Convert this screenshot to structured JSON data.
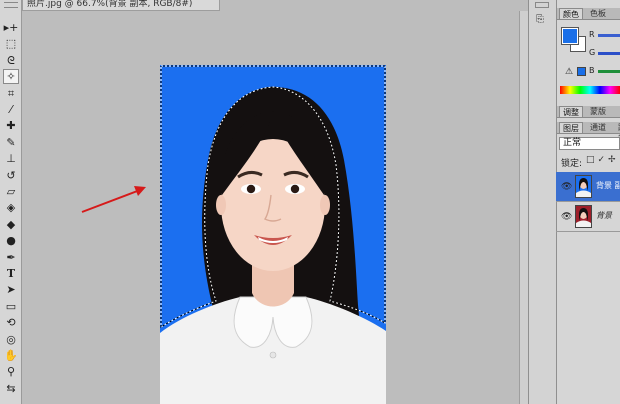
{
  "document": {
    "tab_title": "照片.jpg @ 66.7%(背景 副本, RGB/8#)"
  },
  "toolbar": {
    "tools": [
      {
        "icon": "move-icon",
        "glyph": "▸+"
      },
      {
        "icon": "marquee-icon",
        "glyph": "⬚"
      },
      {
        "icon": "lasso-icon",
        "glyph": "ᘓ"
      },
      {
        "icon": "magic-wand-icon",
        "glyph": "✧",
        "active": true
      },
      {
        "icon": "crop-icon",
        "glyph": "⌗"
      },
      {
        "icon": "eyedropper-icon",
        "glyph": "⁄"
      },
      {
        "icon": "healing-brush-icon",
        "glyph": "✚"
      },
      {
        "icon": "brush-icon",
        "glyph": "✎"
      },
      {
        "icon": "clone-stamp-icon",
        "glyph": "⊥"
      },
      {
        "icon": "history-brush-icon",
        "glyph": "↺"
      },
      {
        "icon": "eraser-icon",
        "glyph": "▱"
      },
      {
        "icon": "paint-bucket-icon",
        "glyph": "◈"
      },
      {
        "icon": "blur-icon",
        "glyph": "◆"
      },
      {
        "icon": "dodge-icon",
        "glyph": "●"
      },
      {
        "icon": "pen-icon",
        "glyph": "✒"
      },
      {
        "icon": "type-icon",
        "glyph": "T"
      },
      {
        "icon": "path-selection-icon",
        "glyph": "➤"
      },
      {
        "icon": "shape-icon",
        "glyph": "▭"
      },
      {
        "icon": "3d-rotate-icon",
        "glyph": "⟲"
      },
      {
        "icon": "3d-orbit-icon",
        "glyph": "◎"
      },
      {
        "icon": "hand-icon",
        "glyph": "✋"
      },
      {
        "icon": "zoom-icon",
        "glyph": "⚲"
      },
      {
        "icon": "swap-colors-icon",
        "glyph": "⇆"
      }
    ]
  },
  "color_panel": {
    "tabs": [
      "颜色",
      "色板"
    ],
    "channels": [
      {
        "label": "R",
        "color": "#d22"
      },
      {
        "label": "G",
        "color": "#2a2"
      },
      {
        "label": "B",
        "color": "#22c"
      }
    ],
    "foreground": "#1a6fe8",
    "background": "#ffffff",
    "warning_glyph": "⚠"
  },
  "adjust_panel": {
    "tabs": [
      "调整",
      "蒙版"
    ]
  },
  "layers_panel": {
    "tabs": [
      "图层",
      "通道",
      "路径"
    ],
    "blend_mode": "正常",
    "lock_label": "锁定:",
    "lock_icons": "□✓✢",
    "layers": [
      {
        "name": "背景 副本",
        "selected": true
      },
      {
        "name": "背景",
        "selected": false
      }
    ]
  },
  "canvas": {
    "photo_background": "#1b6ff0"
  }
}
